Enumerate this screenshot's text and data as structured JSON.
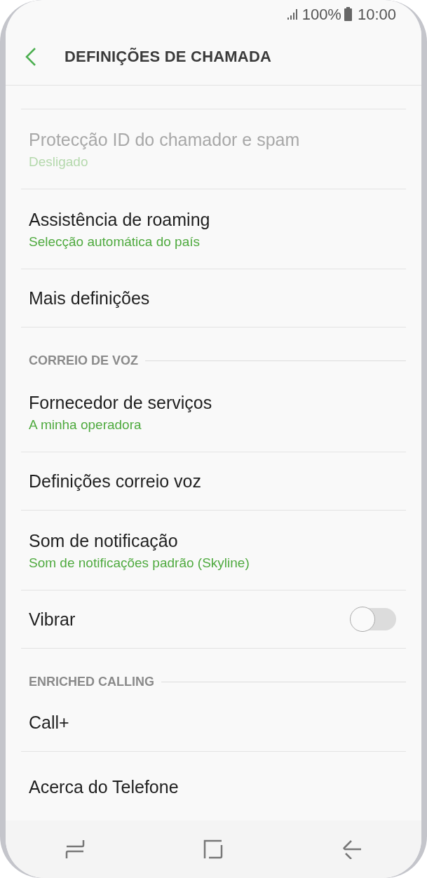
{
  "status_bar": {
    "battery": "100%",
    "time": "10:00"
  },
  "header": {
    "title": "DEFINIÇÕES DE CHAMADA"
  },
  "items": [
    {
      "kind": "setting",
      "title": "Protecção ID do chamador e spam",
      "subtitle": "Desligado",
      "disabled": true
    },
    {
      "kind": "setting",
      "title": "Assistência de roaming",
      "subtitle": "Selecção automática do país",
      "disabled": false
    },
    {
      "kind": "setting",
      "title": "Mais definições",
      "disabled": false
    },
    {
      "kind": "section",
      "title": "CORREIO DE VOZ"
    },
    {
      "kind": "setting",
      "title": "Fornecedor de serviços",
      "subtitle": "A minha operadora",
      "disabled": false
    },
    {
      "kind": "setting",
      "title": "Definições correio voz",
      "disabled": false
    },
    {
      "kind": "setting",
      "title": "Som de notificação",
      "subtitle": "Som de notificações padrão (Skyline)",
      "disabled": false
    },
    {
      "kind": "toggle",
      "title": "Vibrar",
      "on": false,
      "disabled": false
    },
    {
      "kind": "section",
      "title": "ENRICHED CALLING"
    },
    {
      "kind": "setting",
      "title": "Call+",
      "disabled": false
    },
    {
      "kind": "setting",
      "title": "Acerca do Telefone",
      "disabled": false
    }
  ]
}
